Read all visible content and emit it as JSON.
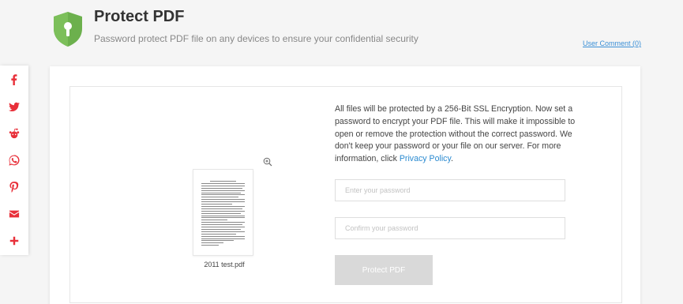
{
  "header": {
    "title": "Protect PDF",
    "subtitle": "Password protect PDF file on any devices to ensure your confidential security",
    "user_comment": "User Comment (0)",
    "logo_icon": "shield-lock-icon",
    "logo_color": "#6cb04d"
  },
  "share": {
    "color": "#e8303a",
    "items": [
      {
        "name": "facebook",
        "icon": "facebook-icon"
      },
      {
        "name": "twitter",
        "icon": "twitter-icon"
      },
      {
        "name": "reddit",
        "icon": "reddit-icon"
      },
      {
        "name": "whatsapp",
        "icon": "whatsapp-icon"
      },
      {
        "name": "pinterest",
        "icon": "pinterest-icon"
      },
      {
        "name": "email",
        "icon": "email-icon"
      },
      {
        "name": "more",
        "icon": "plus-icon"
      }
    ]
  },
  "preview": {
    "file_name": "2011 test.pdf",
    "zoom_icon": "zoom-in-icon"
  },
  "form": {
    "description": "All files will be protected by a 256-Bit SSL Encryption. Now set a password to encrypt your PDF file. This will make it impossible to open or remove the protection without the correct password. We don't keep your password or your file on our server. For more information, click ",
    "privacy_link": "Privacy Policy",
    "description_end": ".",
    "password_placeholder": "Enter your password",
    "confirm_placeholder": "Confirm your password",
    "button_label": "Protect PDF",
    "link_color": "#2a8ad0",
    "button_color": "#d9d9d9"
  }
}
